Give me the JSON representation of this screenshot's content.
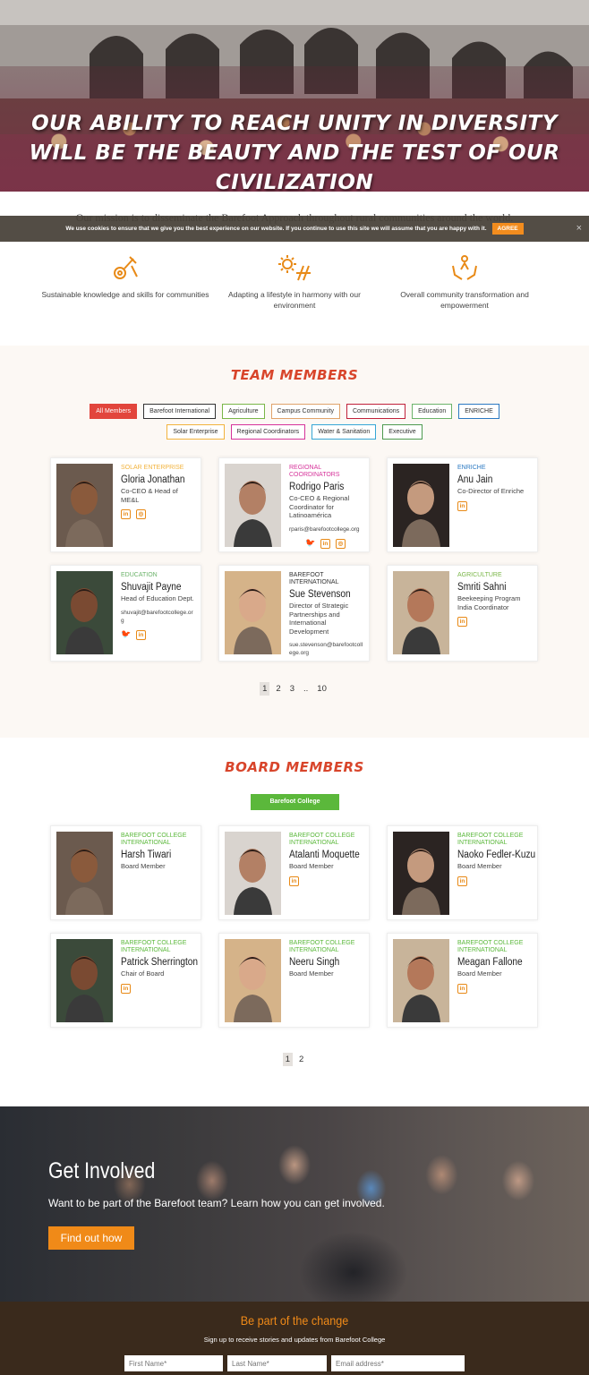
{
  "hero": {
    "quote": "Our ability to reach unity in diversity will be the beauty and the test of our civilization"
  },
  "mission_text": "Our mission is to disseminate the Barefoot Approach throughout rural communities around the world.",
  "cookie": {
    "message": "We use cookies to ensure that we give you the best experience on our website. If you continue to use this site we will assume that you are happy with it.",
    "agree_label": "AGREE",
    "close": "×"
  },
  "features": [
    {
      "icon": "tools-icon",
      "text": "Sustainable knowledge and skills for communities"
    },
    {
      "icon": "sun-icon",
      "text": "Adapting a lifestyle in harmony with our environment"
    },
    {
      "icon": "hands-icon",
      "text": "Overall community transformation and empowerment"
    }
  ],
  "team": {
    "title": "Team Members",
    "filters": [
      {
        "label": "All Members",
        "color": "#e2453c",
        "active": true
      },
      {
        "label": "Barefoot International",
        "color": "#333333"
      },
      {
        "label": "Agriculture",
        "color": "#7ab648"
      },
      {
        "label": "Campus Community",
        "color": "#e0a36b"
      },
      {
        "label": "Communications",
        "color": "#c0213a"
      },
      {
        "label": "Education",
        "color": "#6cb36a"
      },
      {
        "label": "ENRICHE",
        "color": "#2b79c2"
      },
      {
        "label": "Solar Enterprise",
        "color": "#f2b33d"
      },
      {
        "label": "Regional Coordinators",
        "color": "#d6339a"
      },
      {
        "label": "Water & Sanitation",
        "color": "#36a6d6"
      },
      {
        "label": "Executive",
        "color": "#4e9a4f"
      }
    ],
    "members": [
      {
        "category": "Solar Enterprise",
        "cat_color": "#f2b33d",
        "name": "Gloria Jonathan",
        "role": "Co-CEO & Head of ME&L",
        "email": "",
        "socials": [
          "in",
          "ig"
        ]
      },
      {
        "category": "Regional Coordinators",
        "cat_color": "#d6339a",
        "name": "Rodrigo Paris",
        "role": "Co-CEO & Regional Coordinator for Latinoamérica",
        "email": "rparis@barefootcollege.org",
        "socials": [
          "tw",
          "in",
          "ig"
        ]
      },
      {
        "category": "ENRICHE",
        "cat_color": "#2b79c2",
        "name": "Anu Jain",
        "role": "Co-Director of Enriche",
        "email": "",
        "socials": [
          "in"
        ]
      },
      {
        "category": "Education",
        "cat_color": "#6cb36a",
        "name": "Shuvajit Payne",
        "role": "Head of Education Dept.",
        "email": "shuvajit@barefootcollege.org",
        "socials": [
          "tw",
          "in"
        ]
      },
      {
        "category": "Barefoot International",
        "cat_color": "#333333",
        "name": "Sue Stevenson",
        "role": "Director of Strategic Partnerships and International Development",
        "email": "sue.stevenson@barefootcollege.org",
        "socials": []
      },
      {
        "category": "Agriculture",
        "cat_color": "#7ab648",
        "name": "Smriti Sahni",
        "role": "Beekeeping Program India Coordinator",
        "email": "",
        "socials": [
          "in"
        ]
      }
    ],
    "pages": [
      "1",
      "2",
      "3",
      "..",
      "10"
    ]
  },
  "board": {
    "title": "Board Members",
    "filter": "Barefoot College International",
    "members": [
      {
        "category": "Barefoot College International",
        "name": "Harsh Tiwari",
        "role": "Board Member",
        "socials": []
      },
      {
        "category": "Barefoot College International",
        "name": "Atalanti Moquette",
        "role": "Board Member",
        "socials": [
          "in"
        ]
      },
      {
        "category": "Barefoot College International",
        "name": "Naoko Fedler-Kuzu",
        "role": "Board Member",
        "socials": [
          "in"
        ]
      },
      {
        "category": "Barefoot College International",
        "name": "Patrick Sherrington",
        "role": "Chair of Board",
        "socials": [
          "in"
        ]
      },
      {
        "category": "Barefoot College International",
        "name": "Neeru Singh",
        "role": "Board Member",
        "socials": []
      },
      {
        "category": "Barefoot College International",
        "name": "Meagan Fallone",
        "role": "Board Member",
        "socials": [
          "in"
        ]
      }
    ],
    "pages": [
      "1",
      "2"
    ],
    "cat_color": "#5bb83b"
  },
  "get_involved": {
    "title": "Get Involved",
    "text": "Want to be part of the Barefoot team? Learn how you can get involved.",
    "button": "Find out how"
  },
  "footer": {
    "title": "Be part of the change",
    "text": "Sign up to receive stories and updates from Barefoot College",
    "first_name_placeholder": "First Name*",
    "last_name_placeholder": "Last Name*",
    "email_placeholder": "Email address*"
  },
  "colors": {
    "accent": "#f08a18",
    "title_red": "#d8452b",
    "footer_bg": "#3a2a1c"
  }
}
